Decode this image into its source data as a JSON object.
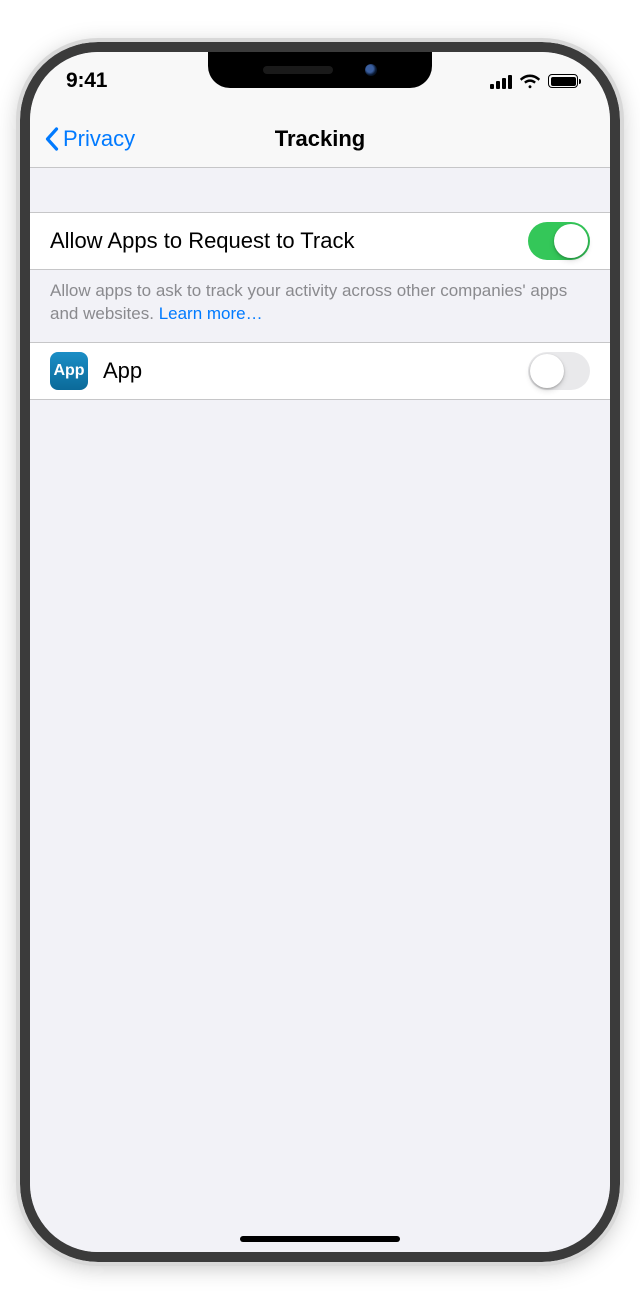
{
  "status": {
    "time": "9:41"
  },
  "nav": {
    "back_label": "Privacy",
    "title": "Tracking"
  },
  "allow_row": {
    "label": "Allow Apps to Request to Track",
    "on": true
  },
  "footer": {
    "text": "Allow apps to ask to track your activity across other companies' apps and websites. ",
    "link_text": "Learn more…"
  },
  "apps": [
    {
      "icon_label": "App",
      "name": "App",
      "on": false
    }
  ]
}
